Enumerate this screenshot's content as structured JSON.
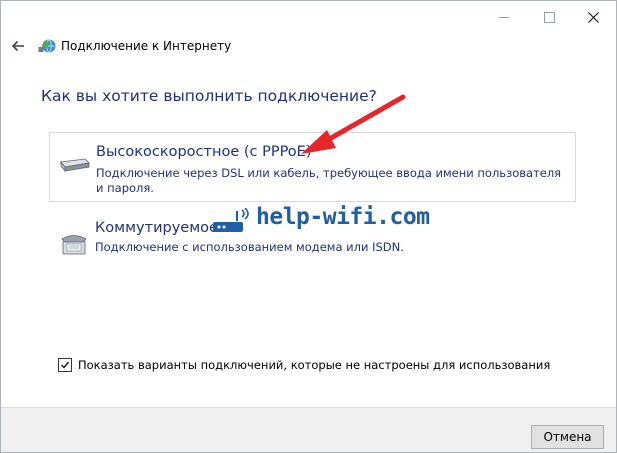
{
  "window": {
    "title": "Подключение к Интернету",
    "heading": "Как вы хотите выполнить подключение?"
  },
  "options": [
    {
      "title": "Высокоскоростное (с PPPoE)",
      "description": "Подключение через DSL или кабель, требующее ввода имени пользователя и пароля.",
      "icon": "modem-icon"
    },
    {
      "title": "Коммутируемое",
      "description": "Подключение с использованием модема или ISDN.",
      "icon": "dialup-phone-icon"
    }
  ],
  "show_options_checkbox": {
    "label": "Показать варианты подключений, которые не настроены для использования",
    "checked": true
  },
  "buttons": {
    "cancel": "Отмена"
  },
  "watermark": {
    "text": "help-wifi.com"
  },
  "colors": {
    "link_blue": "#1e3287",
    "arrow_red": "#e8262a",
    "watermark_blue": "#1f5fa8"
  }
}
